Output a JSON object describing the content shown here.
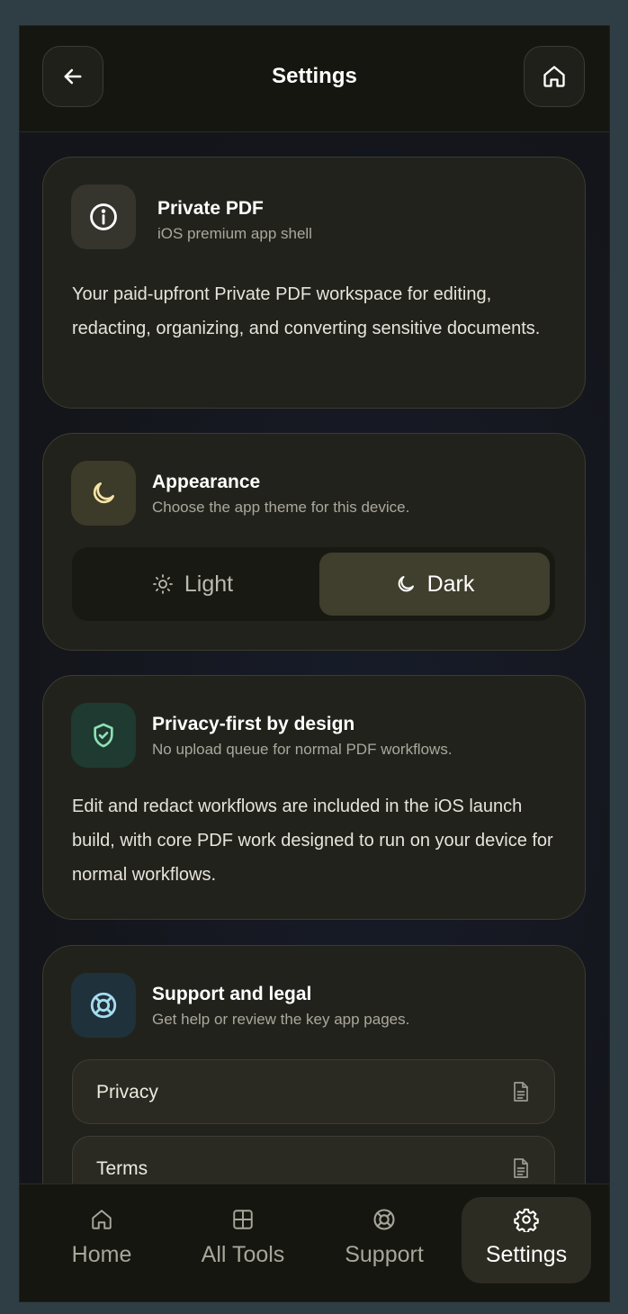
{
  "header": {
    "title": "Settings",
    "back_icon": "arrow-left-icon",
    "home_icon": "home-icon"
  },
  "about": {
    "icon": "info-icon",
    "title": "Private PDF",
    "subtitle": "iOS premium app shell",
    "body": "Your paid-upfront Private PDF workspace for editing, redacting, organizing, and converting sensitive documents."
  },
  "appearance": {
    "icon": "moon-icon",
    "title": "Appearance",
    "subtitle": "Choose the app theme for this device.",
    "options": [
      {
        "label": "Light",
        "icon": "sun-icon",
        "selected": false
      },
      {
        "label": "Dark",
        "icon": "moon-icon",
        "selected": true
      }
    ]
  },
  "privacy": {
    "icon": "shield-check-icon",
    "title": "Privacy-first by design",
    "subtitle": "No upload queue for normal PDF workflows.",
    "body": "Edit and redact workflows are included in the iOS launch build, with core PDF work designed to run on your device for normal workflows."
  },
  "support": {
    "icon": "lifebuoy-icon",
    "title": "Support and legal",
    "subtitle": "Get help or review the key app pages.",
    "links": [
      {
        "label": "Privacy",
        "icon": "document-icon"
      },
      {
        "label": "Terms",
        "icon": "document-icon"
      }
    ]
  },
  "tabbar": {
    "items": [
      {
        "label": "Home",
        "icon": "home-icon",
        "active": false
      },
      {
        "label": "All Tools",
        "icon": "grid-icon",
        "active": false
      },
      {
        "label": "Support",
        "icon": "lifebuoy-icon",
        "active": false
      },
      {
        "label": "Settings",
        "icon": "gear-icon",
        "active": true
      }
    ]
  },
  "colors": {
    "background": "#14151a",
    "card": "#22221c",
    "accent_selected": "#403e2c",
    "info_icon_bg": "#35342d",
    "moon_icon_bg": "#3c3a28",
    "moon_icon": "#f3e3a6",
    "shield_icon_bg": "#1f3a30",
    "shield_icon": "#8ee0b6",
    "lifebuoy_icon_bg": "#1f313a",
    "lifebuoy_icon": "#a6dcf0"
  }
}
